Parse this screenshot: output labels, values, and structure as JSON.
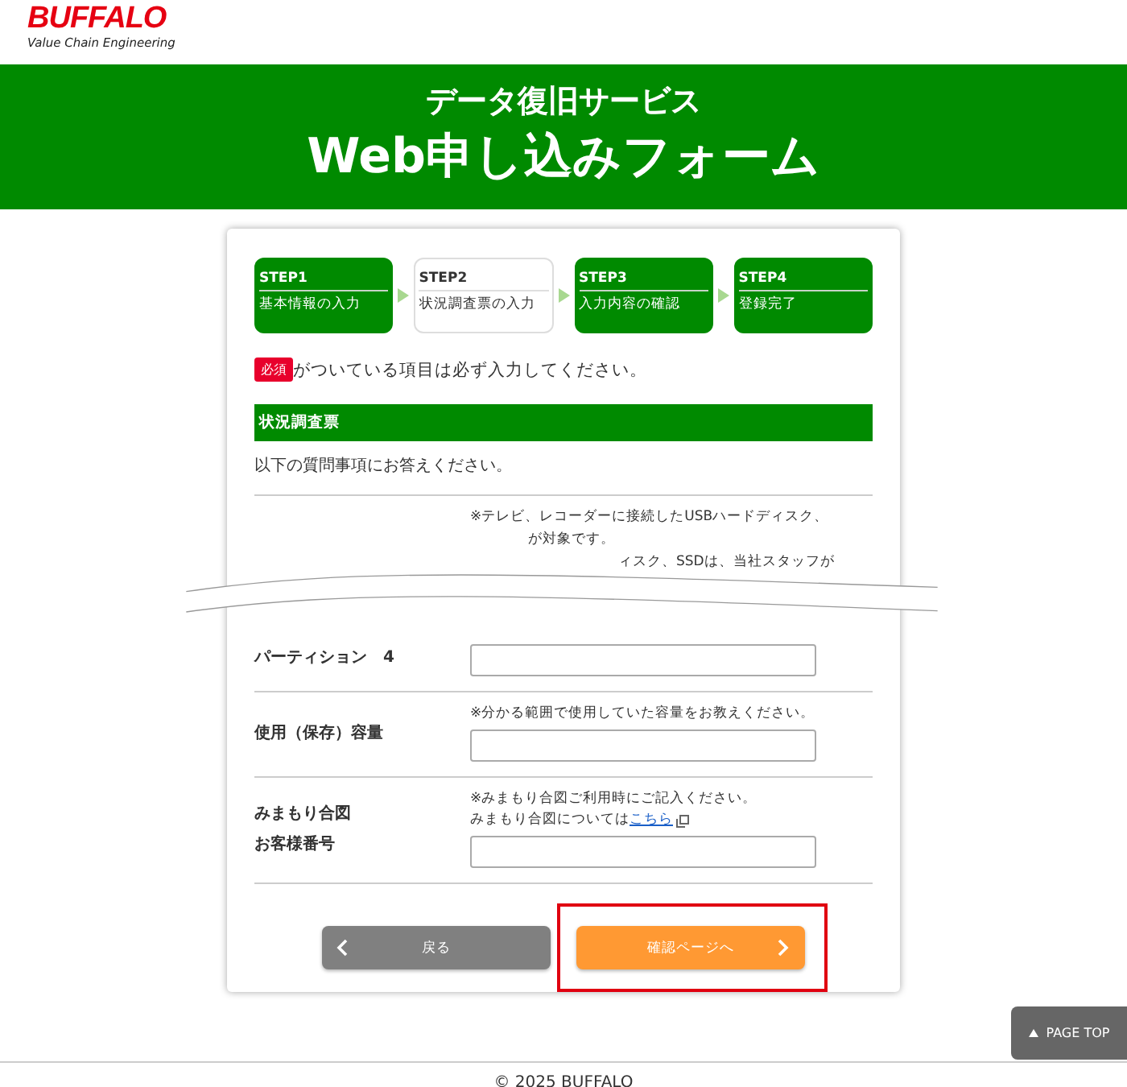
{
  "logo": {
    "name": "BUFFALO",
    "tagline": "Value Chain Engineering"
  },
  "banner": {
    "subtitle": "データ復旧サービス",
    "title": "Web申し込みフォーム"
  },
  "steps": [
    {
      "step": "STEP1",
      "label": "基本情報の入力",
      "selected": false
    },
    {
      "step": "STEP2",
      "label": "状況調査票の入力",
      "selected": true
    },
    {
      "step": "STEP3",
      "label": "入力内容の確認",
      "selected": false
    },
    {
      "step": "STEP4",
      "label": "登録完了",
      "selected": false
    }
  ],
  "required_notice": {
    "badge": "必須",
    "text": "がついている項目は必ず入力してください。"
  },
  "section": {
    "title": "状況調査票",
    "intro": "以下の質問事項にお答えください。"
  },
  "cut_notes": [
    "※テレビ、レコーダーに接続したUSBハードディスク、",
    "が対象です。",
    "ィスク、SSDは、当社スタッフが"
  ],
  "fields": [
    {
      "label": [
        "パーティション　4"
      ]
    },
    {
      "label": [
        "使用（保存）容量"
      ],
      "notes": [
        {
          "text": "※分かる範囲で使用していた容量をお教えください。"
        }
      ]
    },
    {
      "label": [
        "みまもり合図",
        "お客様番号"
      ],
      "notes": [
        {
          "text": "※みまもり合図ご利用時にご記入ください。"
        },
        {
          "text": "みまもり合図については",
          "link": "こちら"
        }
      ]
    }
  ],
  "buttons": [
    {
      "label": "戻る",
      "kind": "back",
      "highlighted": false
    },
    {
      "label": "確認ページへ",
      "kind": "next",
      "highlighted": true
    }
  ],
  "page_top": {
    "label": "PAGE TOP"
  },
  "footer": {
    "copyright": "© 2025 BUFFALO"
  }
}
